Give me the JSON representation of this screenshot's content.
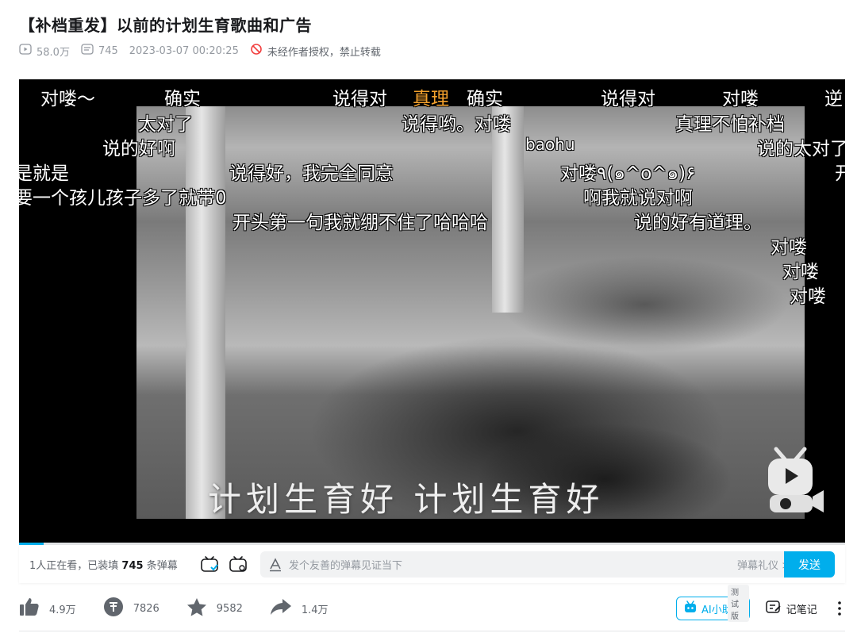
{
  "video": {
    "title": "【补档重发】以前的计划生育歌曲和广告",
    "views": "58.0万",
    "danmaku_count": "745",
    "datetime": "2023-03-07 00:20:25",
    "copyright": "未经作者授权，禁止转载",
    "frame_subtitle": "计划生育好 计划生育好"
  },
  "danmaku": [
    {
      "text": "对喽～"
    },
    {
      "text": "确实"
    },
    {
      "text": "说得对"
    },
    {
      "text": "真理"
    },
    {
      "text": "确实"
    },
    {
      "text": "说得对"
    },
    {
      "text": "对喽"
    },
    {
      "text": "逆"
    },
    {
      "text": "太对了"
    },
    {
      "text": "说得哟。对喽"
    },
    {
      "text": "真理不怕补档"
    },
    {
      "text": "说的好啊"
    },
    {
      "text": "baohu"
    },
    {
      "text": "说的太对了"
    },
    {
      "text": "是就是"
    },
    {
      "text": "说得好，我完全同意"
    },
    {
      "text": "对喽٩(๑^o^๑)۶"
    },
    {
      "text": "开"
    },
    {
      "text": "要一个孩儿孩子多了就带0"
    },
    {
      "text": "啊我就说对啊"
    },
    {
      "text": "开头第一句我就绷不住了哈哈哈"
    },
    {
      "text": "说的好有道理。"
    },
    {
      "text": "对喽"
    },
    {
      "text": "对喽"
    },
    {
      "text": "对喽"
    }
  ],
  "danmaku_bar": {
    "viewers_prefix": "1人正在看，已装填",
    "count": "745",
    "viewers_suffix": "条弹幕",
    "placeholder": "发个友善的弹幕见证当下",
    "etiquette": "弹幕礼仪 >",
    "send": "发送"
  },
  "playback": {
    "progress": 0.03
  },
  "actions": {
    "like": "4.9万",
    "coin": "7826",
    "favorite": "9582",
    "share": "1.4万"
  },
  "tools": {
    "ai_badge": "测试版",
    "ai_label": "AI小助手",
    "notes": "记笔记"
  },
  "colors": {
    "accent": "#00aeec",
    "danmaku_highlight": "#f3a12d"
  }
}
